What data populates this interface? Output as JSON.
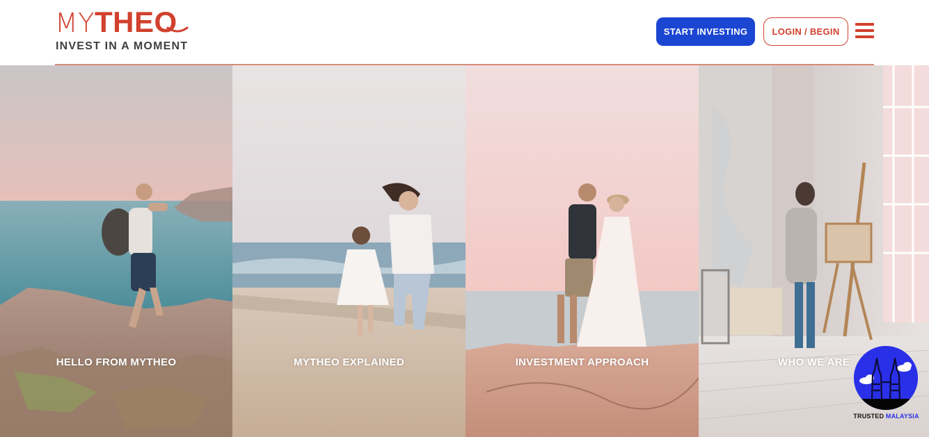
{
  "brand": {
    "logo_thin": "MY",
    "logo_bold": "THEO",
    "tagline": "INVEST IN A MOMENT",
    "color": "#d1412e"
  },
  "header": {
    "start_investing": "START INVESTING",
    "login": "LOGIN / BEGIN",
    "menu_icon": "hamburger-menu-icon",
    "start_color": "#1b46d2"
  },
  "panels": [
    {
      "label": "HELLO FROM MYTHEO",
      "scene": "hiker-on-coastal-cliff"
    },
    {
      "label": "MYTHEO EXPLAINED",
      "scene": "mother-and-daughter-running-on-beach"
    },
    {
      "label": "INVESTMENT APPROACH",
      "scene": "couple-embracing-on-rock-by-sea"
    },
    {
      "label": "WHO WE ARE",
      "scene": "woman-painting-at-easel-in-loft"
    }
  ],
  "badge": {
    "text_main": "TRUSTED",
    "text_accent": "MALAYSIA",
    "icon": "petronas-towers-icon",
    "color": "#2a30e8"
  }
}
